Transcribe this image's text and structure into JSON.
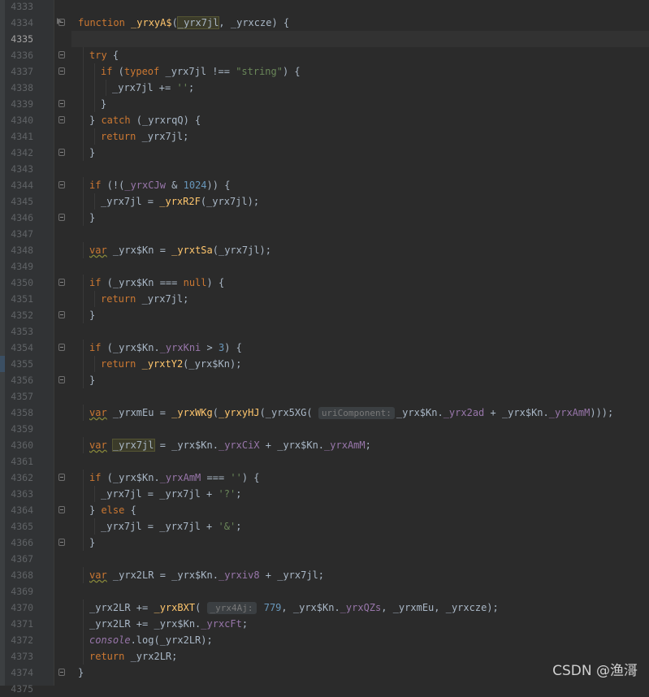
{
  "editor": {
    "lines": [
      {
        "num": "4333",
        "html": ""
      },
      {
        "num": "4334",
        "fold": true,
        "html": "<span class='k'>function</span> <span class='fn'>_yrxyA$</span>(<span class='hl'>_yrx7jl</span>, _yrxcze) {"
      },
      {
        "num": "4335",
        "current": true,
        "html": ""
      },
      {
        "num": "4336",
        "fold": true,
        "indent": 1,
        "html": "<span class='k'>try</span> {"
      },
      {
        "num": "4337",
        "fold": true,
        "indent": 2,
        "html": "<span class='k'>if</span> (<span class='k'>typeof</span> _yrx7jl !== <span class='s'>\"string\"</span>) {"
      },
      {
        "num": "4338",
        "indent": 3,
        "html": "_yrx7jl += <span class='s'>''</span>;"
      },
      {
        "num": "4339",
        "fold": true,
        "indent": 2,
        "html": "}"
      },
      {
        "num": "4340",
        "fold": true,
        "indent": 1,
        "html": "} <span class='k'>catch</span> (_yrxrqQ) {"
      },
      {
        "num": "4341",
        "indent": 2,
        "html": "<span class='k'>return</span> _yrx7jl;"
      },
      {
        "num": "4342",
        "fold": true,
        "indent": 1,
        "html": "}"
      },
      {
        "num": "4343",
        "html": ""
      },
      {
        "num": "4344",
        "fold": true,
        "indent": 1,
        "html": "<span class='k'>if</span> (!(<span class='p'>_yrxCJw</span> &amp; <span class='n'>1024</span>)) {"
      },
      {
        "num": "4345",
        "indent": 2,
        "html": "_yrx7jl = <span class='fn'>_yrxR2F</span>(_yrx7jl);"
      },
      {
        "num": "4346",
        "fold": true,
        "indent": 1,
        "html": "}"
      },
      {
        "num": "4347",
        "html": ""
      },
      {
        "num": "4348",
        "indent": 1,
        "html": "<span class='var-kw'>var</span> _yrx$Kn = <span class='fn'>_yrxtSa</span>(_yrx7jl);"
      },
      {
        "num": "4349",
        "html": ""
      },
      {
        "num": "4350",
        "fold": true,
        "indent": 1,
        "html": "<span class='k'>if</span> (_yrx$Kn === <span class='k'>null</span>) {"
      },
      {
        "num": "4351",
        "indent": 2,
        "html": "<span class='k'>return</span> _yrx7jl;"
      },
      {
        "num": "4352",
        "fold": true,
        "indent": 1,
        "html": "}"
      },
      {
        "num": "4353",
        "html": ""
      },
      {
        "num": "4354",
        "fold": true,
        "indent": 1,
        "html": "<span class='k'>if</span> (_yrx$Kn.<span class='p'>_yrxKni</span> &gt; <span class='n'>3</span>) {"
      },
      {
        "num": "4355",
        "indent": 2,
        "mark": "blue",
        "html": "<span class='k'>return</span> <span class='fn'>_yrxtY2</span>(_yrx$Kn);"
      },
      {
        "num": "4356",
        "fold": true,
        "indent": 1,
        "html": "}"
      },
      {
        "num": "4357",
        "html": ""
      },
      {
        "num": "4358",
        "indent": 1,
        "html": "<span class='var-kw'>var</span> _yrxmEu = <span class='fn'>_yrxWKg</span>(<span class='fn'>_yrxyHJ</span>(_yrx5XG( <span class='hint'>uriComponent:</span>_yrx$Kn.<span class='p'>_yrx2ad</span> + _yrx$Kn.<span class='p'>_yrxAmM</span>)));"
      },
      {
        "num": "4359",
        "html": ""
      },
      {
        "num": "4360",
        "indent": 1,
        "html": "<span class='var-kw'>var</span> <span class='hl'>_yrx7jl</span> = _yrx$Kn.<span class='p'>_yrxCiX</span> + _yrx$Kn.<span class='p'>_yrxAmM</span>;"
      },
      {
        "num": "4361",
        "html": ""
      },
      {
        "num": "4362",
        "fold": true,
        "indent": 1,
        "html": "<span class='k'>if</span> (_yrx$Kn.<span class='p'>_yrxAmM</span> === <span class='s'>''</span>) {"
      },
      {
        "num": "4363",
        "indent": 2,
        "html": "_yrx7jl = _yrx7jl + <span class='s'>'?'</span>;"
      },
      {
        "num": "4364",
        "fold": true,
        "indent": 1,
        "html": "} <span class='k'>else</span> {"
      },
      {
        "num": "4365",
        "indent": 2,
        "html": "_yrx7jl = _yrx7jl + <span class='s'>'&amp;'</span>;"
      },
      {
        "num": "4366",
        "fold": true,
        "indent": 1,
        "html": "}"
      },
      {
        "num": "4367",
        "html": ""
      },
      {
        "num": "4368",
        "indent": 1,
        "html": "<span class='var-kw'>var</span> _yrx2LR = _yrx$Kn.<span class='p'>_yrxiv8</span> + _yrx7jl;"
      },
      {
        "num": "4369",
        "html": ""
      },
      {
        "num": "4370",
        "indent": 1,
        "html": "_yrx2LR += <span class='fn'>_yrxBXT</span>( <span class='hint'>_yrx4Aj:</span> <span class='n'>779</span>, _yrx$Kn.<span class='p'>_yrxQZs</span>, _yrxmEu, _yrxcze);"
      },
      {
        "num": "4371",
        "indent": 1,
        "html": "_yrx2LR += _yrx$Kn.<span class='p'>_yrxcFt</span>;"
      },
      {
        "num": "4372",
        "indent": 1,
        "html": "<span class='it'>console</span>.log(_yrx2LR);"
      },
      {
        "num": "4373",
        "indent": 1,
        "html": "<span class='k'>return</span> _yrx2LR;"
      },
      {
        "num": "4374",
        "fold": true,
        "html": "}"
      },
      {
        "num": "4375",
        "html": ""
      }
    ]
  },
  "watermark": "CSDN @渔滒"
}
